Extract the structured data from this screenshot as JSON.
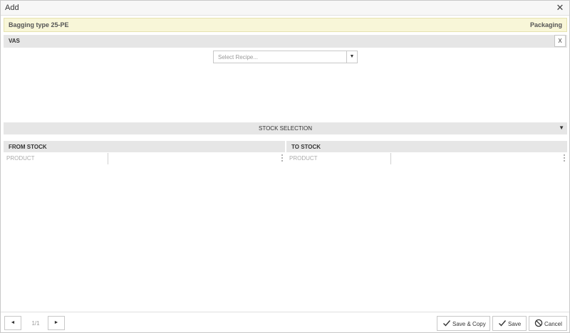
{
  "window": {
    "title": "Add",
    "close_glyph": "✕"
  },
  "info": {
    "left": "Bagging type 25-PE",
    "right": "Packaging"
  },
  "vas": {
    "label": "VAS",
    "remove_label": "X"
  },
  "recipe": {
    "placeholder": "Select Recipe...",
    "arrow": "▼"
  },
  "stock_selection": {
    "label": "STOCK SELECTION",
    "arrow": "▼"
  },
  "from_stock": {
    "title": "FROM STOCK",
    "column": "PRODUCT"
  },
  "to_stock": {
    "title": "TO STOCK",
    "column": "PRODUCT"
  },
  "footer": {
    "prev_glyph": "◄",
    "next_glyph": "►",
    "page_count": "1/1",
    "save_copy_label": "Save & Copy",
    "save_label": "Save",
    "cancel_label": "Cancel"
  },
  "icons": {
    "save_copy": "check-icon",
    "save": "check-icon",
    "cancel": "cancel-circle-icon"
  }
}
